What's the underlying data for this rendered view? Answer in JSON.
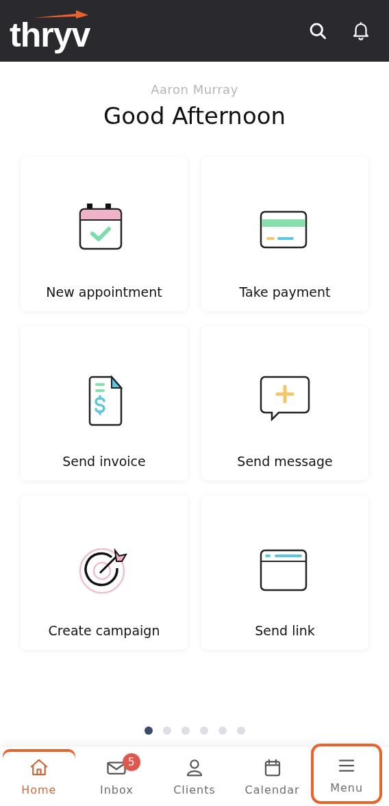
{
  "header": {
    "logo": "thryv"
  },
  "user_name": "Aaron Murray",
  "greeting": "Good Afternoon",
  "actions": [
    {
      "kind": "appointment",
      "label": "New appointment"
    },
    {
      "kind": "payment",
      "label": "Take payment"
    },
    {
      "kind": "invoice",
      "label": "Send invoice"
    },
    {
      "kind": "message",
      "label": "Send message"
    },
    {
      "kind": "campaign",
      "label": "Create campaign"
    },
    {
      "kind": "link",
      "label": "Send link"
    }
  ],
  "pages": [
    {
      "selected": true
    },
    {
      "selected": false
    },
    {
      "selected": false
    },
    {
      "selected": false
    },
    {
      "selected": false
    },
    {
      "selected": false
    }
  ],
  "nav": [
    {
      "kind": "home",
      "label": "Home",
      "selected": true,
      "highlighted": false
    },
    {
      "kind": "inbox",
      "label": "Inbox",
      "selected": false,
      "highlighted": false,
      "badge": "5"
    },
    {
      "kind": "clients",
      "label": "Clients",
      "selected": false,
      "highlighted": false
    },
    {
      "kind": "calendar",
      "label": "Calendar",
      "selected": false,
      "highlighted": false
    },
    {
      "kind": "menu",
      "label": "Menu",
      "selected": false,
      "highlighted": true
    }
  ]
}
